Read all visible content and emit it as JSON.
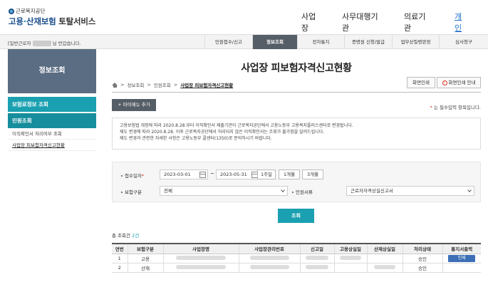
{
  "header": {
    "logo_small": "근로복지공단",
    "logo_part1": "고용",
    "logo_sep": "·",
    "logo_part2": "산재보험",
    "logo_part3": "토탈서비스",
    "nav": [
      "사업장",
      "사무대행기관",
      "의료기관",
      "개인"
    ]
  },
  "bar": {
    "welcome_prefix": "[일반근로자",
    "welcome_suffix": "님 반갑습니다.",
    "menu": [
      "민원접수/신고",
      "정보조회",
      "전자통지",
      "증명원 신청/발급",
      "업무상질병판정",
      "심사청구"
    ],
    "active_index": 1
  },
  "sidebar": {
    "title": "정보조회",
    "cat1": "보험료정보 조회",
    "cat2": "민원조회",
    "items": [
      "이직확인서 처리여부 조회",
      "사업장 피보험자격신고현황"
    ]
  },
  "main": {
    "title": "사업장 피보험자격신고현황",
    "breadcrumb": [
      "정보조회",
      "민원조회",
      "사업장 피보험자격신고현황"
    ],
    "print_btn": "화면인쇄",
    "guide_btn": "화면인쇄 안내",
    "add_menu_btn": "+ 마이메뉴 추가",
    "required_note": "는 필수입력 항목입니다.",
    "required_star": "*",
    "notice_lines": [
      "고용보험법 개정에 따라 2020.8.28.부터 이직확인서 제출기관이 근로복지공단에서 고용노동부 고용복지플러스센터로 변경됩니다.",
      "제도 변경에 따라 2020.8.28. 이후 근로복지공단에서 처리되지 않은 이직확인서는 조회가 불가함을 알려드립니다.",
      "제도 변경과 관련한 자세한 사항은 고용노동부 콜센터(1350)로 문의하시기 바랍니다."
    ]
  },
  "form": {
    "date_label": "접수일자",
    "date_from": "2023-03-01",
    "date_to": "2023-05-31",
    "tilde": "~",
    "periods": [
      "1주일",
      "1개월",
      "3개월"
    ],
    "insurance_label": "보험구분",
    "insurance_value": "전체",
    "type_label": "민원서류",
    "type_value": "근로자자격상실신고서",
    "search_btn": "조회"
  },
  "results": {
    "total_label": "총 조회건",
    "total_count": "2건",
    "columns": [
      "연번",
      "보험구분",
      "사업장명",
      "사업장관리번호",
      "신고일",
      "고용상실일",
      "산재상실일",
      "처리상태",
      "통지서출력"
    ],
    "rows": [
      {
        "no": "1",
        "insurance": "고용",
        "status": "승인",
        "action": "인쇄"
      },
      {
        "no": "2",
        "insurance": "산재",
        "status": "승인",
        "action": ""
      }
    ]
  }
}
